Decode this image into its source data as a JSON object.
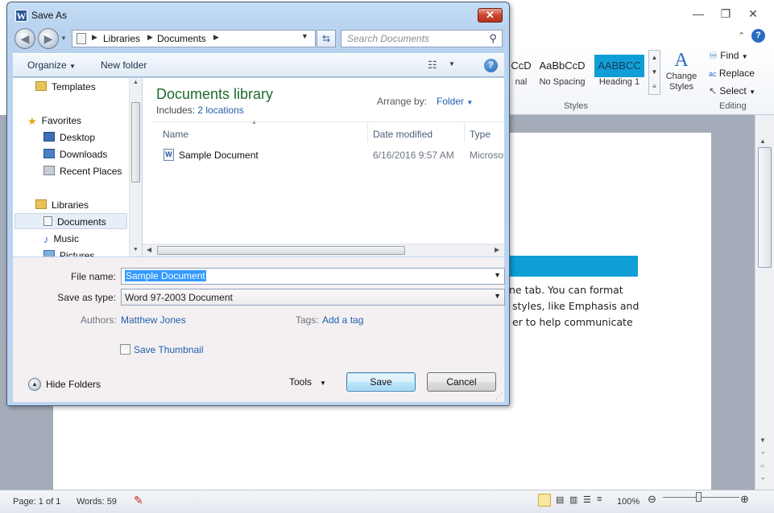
{
  "word": {
    "ribbon_styles": [
      {
        "sample": "CcD",
        "name": "nal"
      },
      {
        "sample": "AaBbCcD",
        "name": "No Spacing"
      },
      {
        "sample": "AABBCC",
        "name": "Heading 1"
      }
    ],
    "change_styles": "Change Styles",
    "group_styles": "Styles",
    "group_editing": "Editing",
    "find_label": "Find",
    "replace_label": "Replace",
    "select_label": "Select",
    "doc_lines": [
      "ne tab. You can format",
      "styles, like Emphasis and",
      "er to help communicate"
    ],
    "status": {
      "page": "Page: 1 of 1",
      "words": "Words: 59",
      "zoom": "100%"
    },
    "highlight_color": "#0f9fd6"
  },
  "dialog": {
    "title": "Save As",
    "title_icon": "W",
    "close_glyph": "✕",
    "address": {
      "crumbs": [
        "Libraries",
        "Documents"
      ]
    },
    "search_placeholder": "Search Documents",
    "toolbar": {
      "organize": "Organize",
      "new_folder": "New folder"
    },
    "nav_pane": {
      "items": [
        {
          "label": "Templates",
          "icon": "folder-icon"
        },
        {
          "label": "Favorites",
          "icon": "star-icon"
        },
        {
          "label": "Desktop",
          "icon": "desktop-icon"
        },
        {
          "label": "Downloads",
          "icon": "downloads-icon"
        },
        {
          "label": "Recent Places",
          "icon": "recent-places-icon"
        },
        {
          "label": "Libraries",
          "icon": "libraries-icon"
        },
        {
          "label": "Documents",
          "icon": "documents-icon"
        },
        {
          "label": "Music",
          "icon": "music-icon"
        },
        {
          "label": "Pictures",
          "icon": "pictures-icon"
        }
      ]
    },
    "library": {
      "title": "Documents library",
      "includes_label": "Includes:",
      "locations": "2 locations",
      "arrange_by_label": "Arrange by:",
      "arrange_by_value": "Folder"
    },
    "columns": [
      "Name",
      "Date modified",
      "Type"
    ],
    "files": [
      {
        "name": "Sample Document",
        "date": "6/16/2016 9:57 AM",
        "type": "Microsoft"
      }
    ],
    "form": {
      "file_name_label": "File name:",
      "file_name_value": "Sample Document",
      "save_type_label": "Save as type:",
      "save_type_value": "Word 97-2003 Document",
      "authors_label": "Authors:",
      "authors_value": "Matthew Jones",
      "tags_label": "Tags:",
      "tags_value": "Add a tag",
      "save_thumbnail": "Save Thumbnail",
      "hide_folders": "Hide Folders",
      "tools": "Tools",
      "save": "Save",
      "cancel": "Cancel"
    },
    "colors": {
      "library_title": "#1e6a2e",
      "link": "#1f5fae",
      "selection": "#3399ff"
    }
  }
}
